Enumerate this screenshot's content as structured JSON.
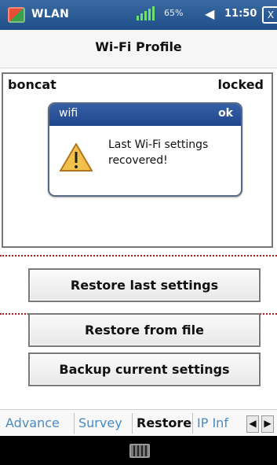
{
  "status_bar": {
    "app_name": "WLAN",
    "battery_text": "65%",
    "time": "11:50",
    "close_label": "X",
    "speaker_glyph": "◀",
    "icons": [
      "windows-start-icon",
      "signal-icon",
      "battery-icon",
      "speaker-icon",
      "close-icon"
    ]
  },
  "header": {
    "title": "Wi-Fi Profile"
  },
  "profiles": [
    {
      "ssid": "boncat",
      "state": "locked"
    }
  ],
  "dialog": {
    "title": "wifi",
    "ok_label": "ok",
    "message_line1": "Last Wi-Fi settings",
    "message_line2": "recovered!",
    "icon": "warning-icon"
  },
  "buttons": {
    "restore_last": "Restore last settings",
    "restore_file": "Restore from file",
    "backup_current": "Backup current settings"
  },
  "tabs": [
    {
      "label": "Advance"
    },
    {
      "label": "Survey"
    },
    {
      "label": "Restore"
    },
    {
      "label": "IP Inf"
    }
  ],
  "active_tab": "Restore",
  "tab_nav": {
    "left": "◀",
    "right": "▶"
  },
  "bottom_bar": {
    "icon": "keyboard-icon"
  },
  "colors": {
    "status_bar": "#2b5a92",
    "dialog_title": "#2a4f97",
    "dotted_marker": "#c1121f",
    "inactive_tab": "#4a8ac4"
  }
}
